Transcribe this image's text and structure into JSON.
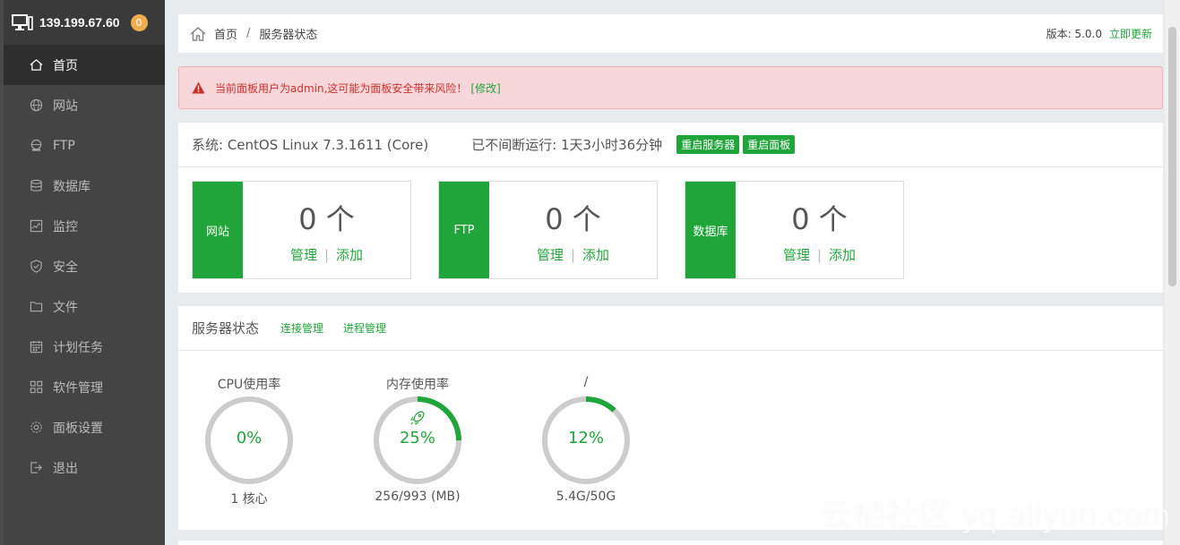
{
  "sidebar": {
    "ip": "139.199.67.60",
    "badge": "0",
    "items": [
      {
        "label": "首页",
        "icon": "home-icon"
      },
      {
        "label": "网站",
        "icon": "globe-icon"
      },
      {
        "label": "FTP",
        "icon": "ftp-icon"
      },
      {
        "label": "数据库",
        "icon": "database-icon"
      },
      {
        "label": "监控",
        "icon": "monitor-chart-icon"
      },
      {
        "label": "安全",
        "icon": "shield-icon"
      },
      {
        "label": "文件",
        "icon": "folder-icon"
      },
      {
        "label": "计划任务",
        "icon": "calendar-icon"
      },
      {
        "label": "软件管理",
        "icon": "apps-icon"
      },
      {
        "label": "面板设置",
        "icon": "gear-icon"
      },
      {
        "label": "退出",
        "icon": "logout-icon"
      }
    ]
  },
  "breadcrumb": {
    "home": "首页",
    "separator": "/",
    "current": "服务器状态",
    "version_label": "版本: 5.0.0",
    "update_link": "立即更新"
  },
  "alert": {
    "message": "当前面板用户为admin,这可能为面板安全带来风险！",
    "link": "[修改]"
  },
  "system": {
    "os": "系统: CentOS Linux 7.3.1611 (Core)",
    "uptime": "已不间断运行: 1天3小时36分钟",
    "restart_server": "重启服务器",
    "restart_panel": "重启面板"
  },
  "stat_cards": [
    {
      "label": "网站",
      "count": "0 个",
      "manage": "管理",
      "add": "添加"
    },
    {
      "label": "FTP",
      "count": "0 个",
      "manage": "管理",
      "add": "添加"
    },
    {
      "label": "数据库",
      "count": "0 个",
      "manage": "管理",
      "add": "添加"
    }
  ],
  "server_status": {
    "title": "服务器状态",
    "link_connections": "连接管理",
    "link_processes": "进程管理",
    "gauges": [
      {
        "title": "CPU使用率",
        "value": "0%",
        "fraction": 0.0,
        "sub": "1 核心"
      },
      {
        "title": "内存使用率",
        "value": "25%",
        "fraction": 0.25,
        "sub": "256/993 (MB)"
      },
      {
        "title": "/",
        "value": "12%",
        "fraction": 0.12,
        "sub": "5.4G/50G"
      }
    ]
  },
  "watermark": "云栖社区 yq.aliyun.com",
  "colors": {
    "accent": "#20a53a",
    "sidebar_bg": "#444444",
    "alert_bg": "#f8d7da",
    "alert_text": "#c9302c",
    "badge": "#f0ad4e",
    "ring_track": "#cccccc"
  }
}
